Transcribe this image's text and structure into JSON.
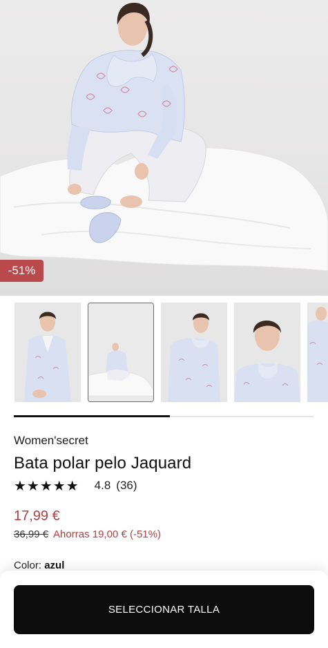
{
  "product": {
    "discount_badge": "-51%",
    "brand": "Women'secret",
    "title": "Bata polar pelo Jaquard",
    "rating": {
      "stars": "★★★★★",
      "value": "4.8",
      "count": "(36)"
    },
    "price": {
      "current": "17,99 €",
      "original": "36,99 €",
      "savings": "Ahorras 19,00 € (-51%)"
    },
    "color": {
      "label": "Color: ",
      "value": "azul"
    }
  },
  "gallery": {
    "thumbnail_count": 5,
    "selected_index": 1,
    "scroll_progress": 0.52
  },
  "footer": {
    "cta_label": "SELECCIONAR TALLA"
  },
  "colors": {
    "accent_red": "#b9494b",
    "cta_black": "#0c0c0c"
  }
}
